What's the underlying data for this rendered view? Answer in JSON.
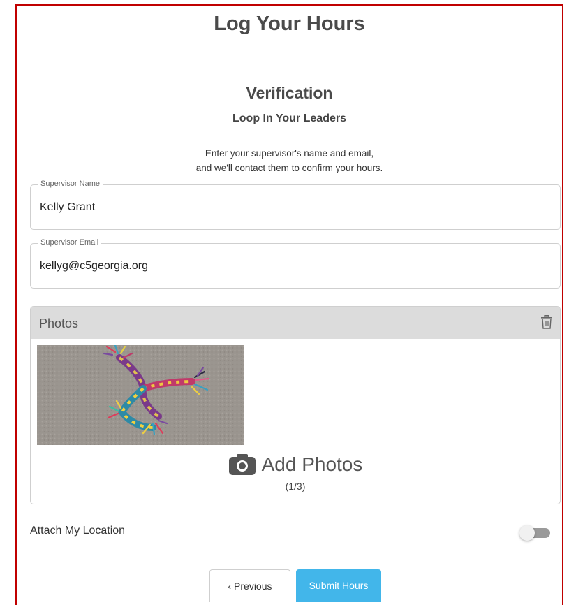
{
  "page": {
    "title": "Log Your Hours"
  },
  "verification": {
    "heading": "Verification",
    "subheading": "Loop In Your Leaders",
    "instructions_line1": "Enter your supervisor's name and email,",
    "instructions_line2": "and we'll contact them to confirm your hours."
  },
  "supervisor_name": {
    "label": "Supervisor Name",
    "value": "Kelly Grant"
  },
  "supervisor_email": {
    "label": "Supervisor Email",
    "value": "kellyg@c5georgia.org"
  },
  "photos": {
    "header": "Photos",
    "delete_icon": "trash-icon",
    "add_icon": "camera-icon",
    "add_label": "Add Photos",
    "count": "(1/3)"
  },
  "location": {
    "label": "Attach My Location",
    "enabled": false
  },
  "buttons": {
    "previous": "‹ Previous",
    "submit": "Submit Hours"
  },
  "colors": {
    "accent": "#42b6ea",
    "frame_border": "#c00000",
    "header_bg": "#dcdcdc"
  }
}
